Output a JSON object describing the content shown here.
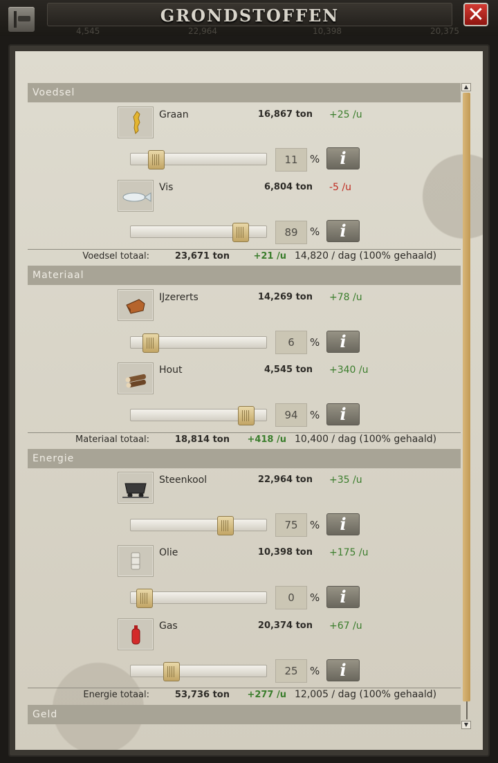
{
  "header": {
    "title": "GRONDSTOFFEN",
    "close_label": "✕",
    "ghost_numbers": [
      "4,545",
      "22,964",
      "10,398",
      "20,375"
    ]
  },
  "sections": {
    "food": {
      "title": "Voedsel",
      "resources": [
        {
          "name": "Graan",
          "amount": "16,867 ton",
          "rate": "+25 /u",
          "percent": "11",
          "pct_sign": "%",
          "slider_value": 11
        },
        {
          "name": "Vis",
          "amount": "6,804 ton",
          "rate": "-5 /u",
          "percent": "89",
          "pct_sign": "%",
          "slider_value": 89
        }
      ],
      "total": {
        "label": "Voedsel totaal:",
        "amount": "23,671 ton",
        "rate": "+21 /u",
        "daily": "14,820 / dag (100% gehaald)"
      }
    },
    "material": {
      "title": "Materiaal",
      "resources": [
        {
          "name": "IJzererts",
          "amount": "14,269 ton",
          "rate": "+78 /u",
          "percent": "6",
          "pct_sign": "%",
          "slider_value": 6
        },
        {
          "name": "Hout",
          "amount": "4,545 ton",
          "rate": "+340 /u",
          "percent": "94",
          "pct_sign": "%",
          "slider_value": 94
        }
      ],
      "total": {
        "label": "Materiaal totaal:",
        "amount": "18,814 ton",
        "rate": "+418 /u",
        "daily": "10,400 / dag (100% gehaald)"
      }
    },
    "energy": {
      "title": "Energie",
      "resources": [
        {
          "name": "Steenkool",
          "amount": "22,964 ton",
          "rate": "+35 /u",
          "percent": "75",
          "pct_sign": "%",
          "slider_value": 75
        },
        {
          "name": "Olie",
          "amount": "10,398 ton",
          "rate": "+175 /u",
          "percent": "0",
          "pct_sign": "%",
          "slider_value": 0
        },
        {
          "name": "Gas",
          "amount": "20,374 ton",
          "rate": "+67 /u",
          "percent": "25",
          "pct_sign": "%",
          "slider_value": 25
        }
      ],
      "total": {
        "label": "Energie totaal:",
        "amount": "53,736 ton",
        "rate": "+277 /u",
        "daily": "12,005 / dag (100% gehaald)"
      }
    },
    "money": {
      "title": "Geld"
    }
  },
  "info_label": "i",
  "scroll": {
    "up": "▲",
    "down": "▼"
  },
  "colors": {
    "positive": "#3a7d2c",
    "negative": "#c02c22",
    "slider_handle": "#c2a565",
    "section_header": "#a8a496"
  },
  "icons": [
    "wheat-icon",
    "fish-icon",
    "iron-ore-icon",
    "wood-logs-icon",
    "coal-cart-icon",
    "oil-barrel-icon",
    "gas-canister-icon"
  ]
}
